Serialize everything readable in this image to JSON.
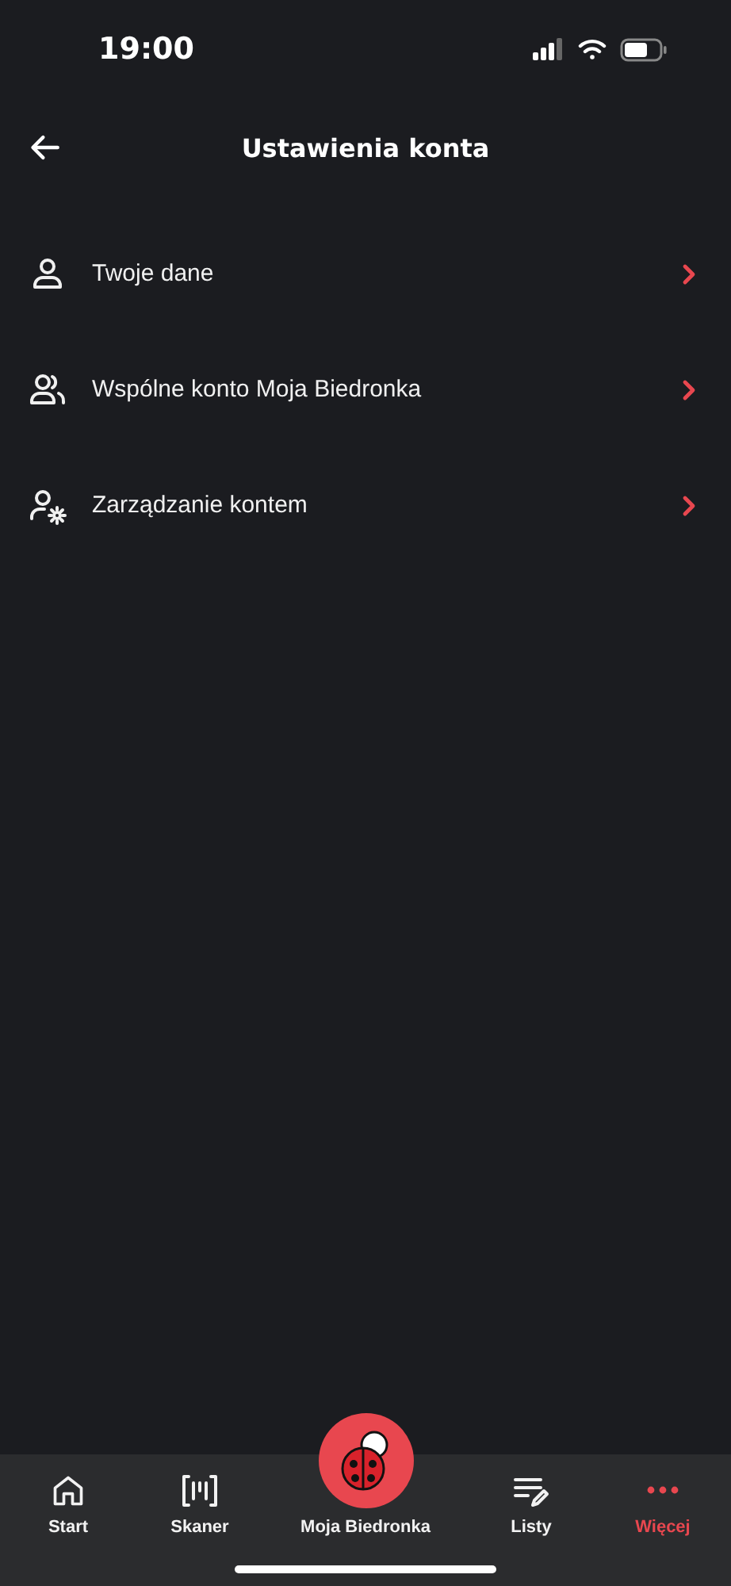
{
  "status_bar": {
    "time": "19:00"
  },
  "header": {
    "title": "Ustawienia konta"
  },
  "menu": [
    {
      "kind": "person",
      "label": "Twoje dane"
    },
    {
      "kind": "people",
      "label": "Wspólne konto Moja Biedronka"
    },
    {
      "kind": "person-gear",
      "label": "Zarządzanie kontem"
    }
  ],
  "tab_bar": [
    {
      "kind": "home",
      "label": "Start",
      "selected": false
    },
    {
      "kind": "scan",
      "label": "Skaner",
      "selected": false
    },
    {
      "kind": "ladybug",
      "label": "Moja Biedronka",
      "selected": false
    },
    {
      "kind": "list",
      "label": "Listy",
      "selected": false
    },
    {
      "kind": "more",
      "label": "Więcej",
      "selected": true
    }
  ]
}
